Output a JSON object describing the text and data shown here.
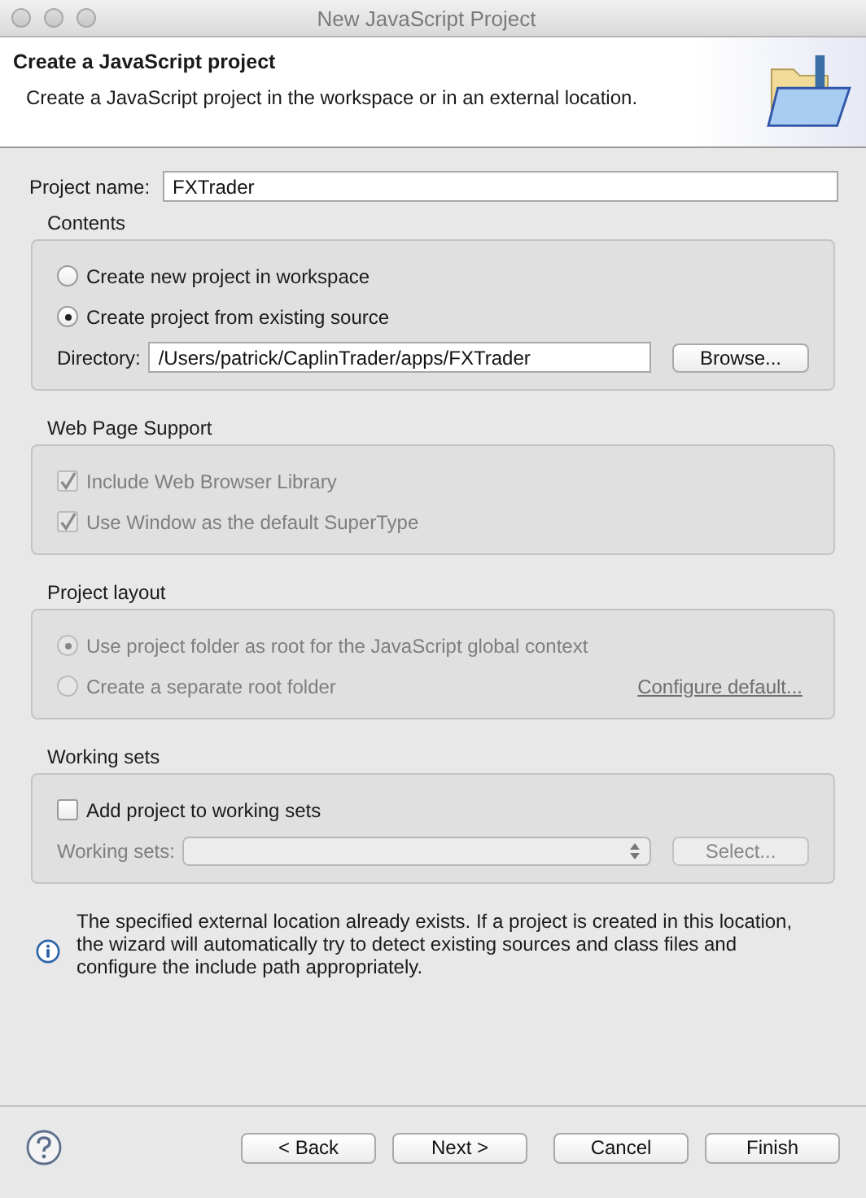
{
  "window": {
    "title": "New JavaScript Project"
  },
  "header": {
    "title": "Create a JavaScript project",
    "description": "Create a JavaScript project in the workspace or in an external location."
  },
  "project_name": {
    "label": "Project name:",
    "value": "FXTrader"
  },
  "groups": [
    {
      "title": "Contents",
      "rows": [
        {
          "kind": "radio",
          "label": "Create new project in workspace",
          "selected": false,
          "disabled": false
        },
        {
          "kind": "radio",
          "label": "Create project from existing source",
          "selected": true,
          "disabled": false
        },
        {
          "kind": "field",
          "label": "Directory:",
          "value": "/Users/patrick/CaplinTrader/apps/FXTrader",
          "button": {
            "label": "Browse...",
            "disabled": false
          }
        }
      ]
    },
    {
      "title": "Web Page Support",
      "rows": [
        {
          "kind": "checkbox",
          "label": "Include Web Browser Library",
          "checked": true,
          "disabled": true
        },
        {
          "kind": "checkbox",
          "label": "Use Window as the default SuperType",
          "checked": true,
          "disabled": true
        }
      ]
    },
    {
      "title": "Project layout",
      "rows": [
        {
          "kind": "radio",
          "label": "Use project folder as root for the JavaScript global context",
          "selected": true,
          "disabled": true
        },
        {
          "kind": "radio",
          "label": "Create a separate root folder",
          "selected": false,
          "disabled": true,
          "link": "Configure default..."
        }
      ]
    },
    {
      "title": "Working sets",
      "rows": [
        {
          "kind": "checkbox",
          "label": "Add project to working sets",
          "checked": false,
          "disabled": false
        },
        {
          "kind": "combo",
          "label": "Working sets:",
          "disabled": true,
          "button": {
            "label": "Select...",
            "disabled": true
          }
        }
      ]
    }
  ],
  "info": "The specified external location already exists. If a project is created in this location, the wizard will automatically try to detect existing sources and class files and configure the include path appropriately.",
  "buttons": [
    {
      "label": "< Back"
    },
    {
      "label": "Next >"
    },
    {
      "label": "Cancel"
    },
    {
      "label": "Finish"
    }
  ]
}
